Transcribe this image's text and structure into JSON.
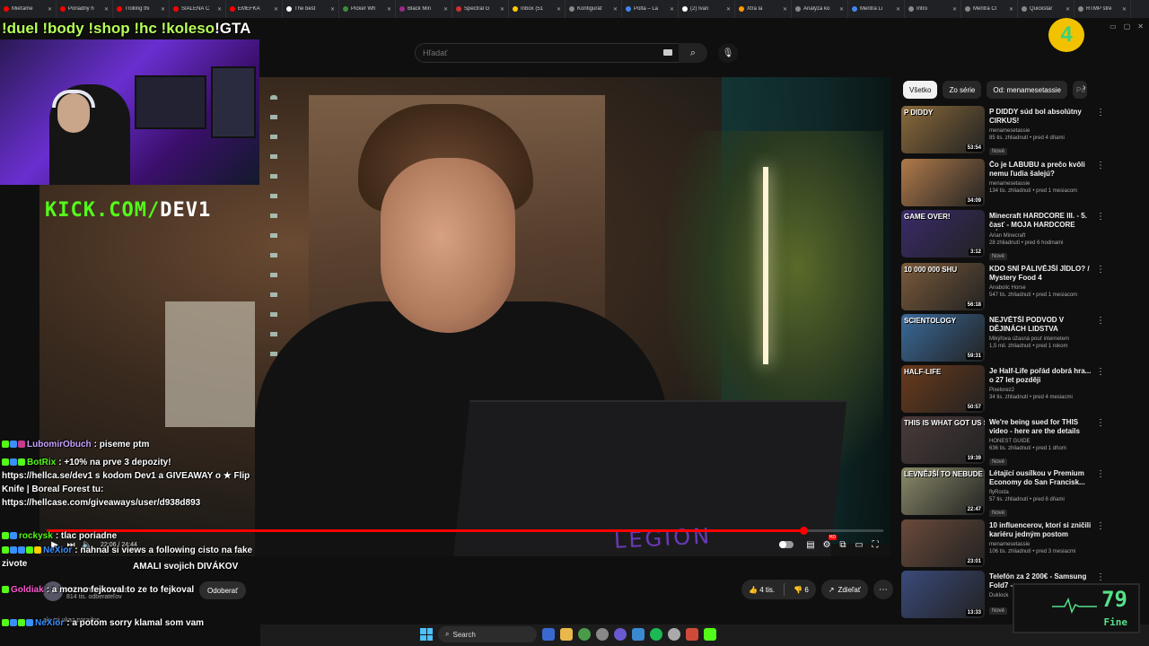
{
  "browser": {
    "tabs": [
      {
        "title": "Mieťame",
        "color": "#ff0000"
      },
      {
        "title": "Poriadny h",
        "color": "#ff0000"
      },
      {
        "title": "Trolling thi",
        "color": "#ff0000"
      },
      {
        "title": "SIALENÁ Č",
        "color": "#ff0000"
      },
      {
        "title": "EMEFKA",
        "color": "#ff0000"
      },
      {
        "title": "The best ",
        "color": "#ffffff"
      },
      {
        "title": "Picker Wh",
        "color": "#3a8f3a"
      },
      {
        "title": "Black Min",
        "color": "#9a2a8a"
      },
      {
        "title": "Spectral G",
        "color": "#d03030"
      },
      {
        "title": "Inbox (51",
        "color": "#ffcc00"
      },
      {
        "title": "Konfiguráť",
        "color": "#888888"
      },
      {
        "title": "Polta – La",
        "color": "#4285f4"
      },
      {
        "title": "(2) Ivan ",
        "color": "#ffffff"
      },
      {
        "title": "Xtra la",
        "color": "#ff9900"
      },
      {
        "title": "Analýza ko",
        "color": "#888888"
      },
      {
        "title": "Mentra Li",
        "color": "#4285f4"
      },
      {
        "title": "Intro",
        "color": "#888888"
      },
      {
        "title": "Mentra Cl",
        "color": "#888888"
      },
      {
        "title": "Quickstar",
        "color": "#888888"
      },
      {
        "title": "RTMP stre",
        "color": "#888888"
      }
    ]
  },
  "overlay": {
    "commands": "!duel !body !shop !hc !koleso",
    "gta": "!GTA",
    "kick_prefix": "KICK.COM/",
    "kick_name": "DEV1"
  },
  "youtube": {
    "search_placeholder": "Hľadať",
    "channel_name": "menamesetassie",
    "channel_subs": "814 tis. odberateľov",
    "subscribe_label": "Odoberať",
    "likes": "4 tis.",
    "dislikes": "6",
    "share_label": "Zdieľať",
    "time_current": "22:06",
    "time_total": "24:44",
    "progress": 0.905,
    "next_hint": "ale mi ukaz poradne"
  },
  "chips": [
    {
      "label": "Všetko",
      "active": true
    },
    {
      "label": "Zo série",
      "active": false
    },
    {
      "label": "Od: menamesetassie",
      "active": false
    },
    {
      "label": "Po",
      "active": false
    }
  ],
  "recommendations": [
    {
      "title": "P DIDDY súd bol absolútny CIRKUS!",
      "channel": "menamesetassie",
      "meta": "85 tis. zhliadnutí • pred 4 dňami",
      "new": "Nové",
      "duration": "53:54",
      "thumb_text": "P DIDDY",
      "bg": "#8a6a3a"
    },
    {
      "title": "Čo je LABUBU a prečo kvôli nemu ľudia šalejú?",
      "channel": "menamesetassie",
      "meta": "134 tis. zhliadnutí • pred 1 mesiacom",
      "new": "",
      "duration": "34:09",
      "thumb_text": "",
      "bg": "#b07a4a"
    },
    {
      "title": "Minecraft HARDCORE III. - 5. časť - MOJA HARDCORE SÉRI...",
      "channel": "Arian Minecraft",
      "meta": "28 zhliadnutí • pred 6 hodinami",
      "new": "Nové",
      "duration": "3:12",
      "thumb_text": "GAME OVER!",
      "bg": "#3a2a6a"
    },
    {
      "title": "KDO SNÍ PÁLIVĚJŠÍ JÍDLO? / Mystery Food 4",
      "channel": "Anabolic Horse",
      "meta": "547 tis. zhliadnutí • pred 1 mesiacom",
      "new": "",
      "duration": "56:18",
      "thumb_text": "10 000 000 SHU",
      "bg": "#7a5a3a"
    },
    {
      "title": "NEJVĚTŠÍ PODVOD V DĚJINÁCH LIDSTVA",
      "channel": "Mikýřova úžasná pouť internetem",
      "meta": "1,5 mil. zhliadnutí • pred 1 rokom",
      "new": "",
      "duration": "59:31",
      "thumb_text": "SCIENTOLOGY",
      "bg": "#3a6a9a"
    },
    {
      "title": "Je Half-Life pořád dobrá hra... o 27 let později",
      "channel": "Pixelorez2",
      "meta": "34 tis. zhliadnutí • pred 4 mesiacmi",
      "new": "",
      "duration": "50:57",
      "thumb_text": "HALF-LIFE",
      "bg": "#6a3a1a"
    },
    {
      "title": "We're being sued for THIS video - here are the details",
      "channel": "HONEST GUIDE",
      "meta": "636 tis. zhliadnutí • pred 1 dňom",
      "new": "Nové",
      "duration": "19:39",
      "thumb_text": "THIS IS WHAT GOT US SUED",
      "bg": "#4a3a3a"
    },
    {
      "title": "Létající ousílkou v Premium Economy do San Francisk...",
      "channel": "flyRosta",
      "meta": "57 tis. zhliadnutí • pred 6 dňami",
      "new": "Nové",
      "duration": "22:47",
      "thumb_text": "LEVNĚJŠÍ TO NEBUDE",
      "bg": "#8a8a6a"
    },
    {
      "title": "10 influencerov, ktorí si zničili kariéru jedným postom",
      "channel": "menamesetassie",
      "meta": "106 tis. zhliadnutí • pred 3 mesiacmi",
      "new": "",
      "duration": "23:01",
      "thumb_text": "",
      "bg": "#6a4a3a"
    },
    {
      "title": "Telefón za 2 200€ - Samsung Fold7 - ...",
      "channel": "Duklock",
      "meta": "",
      "new": "Nové",
      "duration": "13:33",
      "thumb_text": "",
      "bg": "#3a4a7a"
    }
  ],
  "chat": [
    {
      "user": "LubomirObuch",
      "user_color": "#c8a2ff",
      "text": ": piseme ptm"
    },
    {
      "user": "BotRix",
      "user_color": "#53fc18",
      "text": ": +10% na prve 3 depozity! https://hellca.se/dev1 s kodom Dev1 a GIVEAWAY o ★ Flip Knife | Boreal Forest tu: https://hellcase.com/giveaways/user/d938d893"
    },
    {
      "user": "rockysk",
      "user_color": "#53fc18",
      "text": ": tlac poriadne"
    },
    {
      "user": "NeXior",
      "user_color": "#3a8fff",
      "text": ": nahnal si views a following cisto na fake zivote"
    },
    {
      "user": "Goldiak",
      "user_color": "#ff5ad0",
      "text": ": a mozno fejkoval to ze to fejkoval"
    },
    {
      "user": "NeXior",
      "user_color": "#3a8fff",
      "text": ": a potom sorry klamal som vam"
    }
  ],
  "overlay_extra": {
    "chat_overlap": "AMALI svojich DIVÁKOV"
  },
  "taskbar": {
    "search_label": "Search"
  },
  "widget": {
    "value": "79",
    "label": "Fine"
  },
  "colors": {
    "kick_green": "#53fc18",
    "progress_red": "#ff0000",
    "cmd_green": "#b7ff5a"
  }
}
